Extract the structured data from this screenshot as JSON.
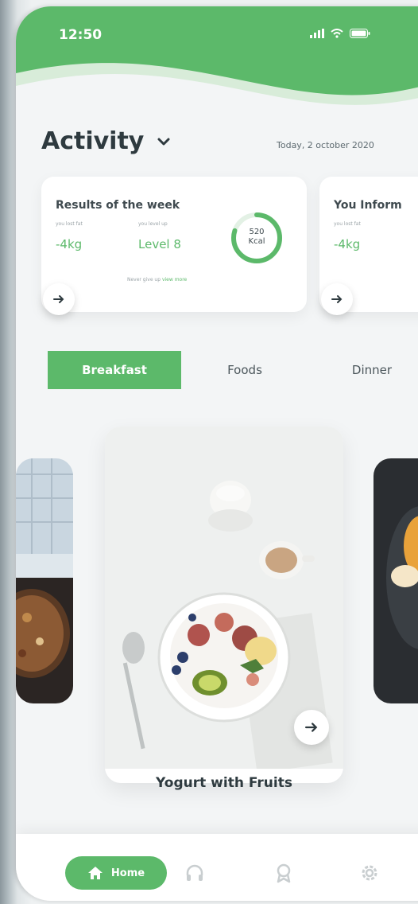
{
  "status_bar": {
    "time": "12:50"
  },
  "header": {
    "title": "Activity",
    "date": "Today, 2 october 2020"
  },
  "card_week": {
    "title": "Results of the week",
    "metric1_label": "you lost fat",
    "metric1_value": "-4kg",
    "metric2_label": "you level up",
    "metric2_value": "Level 8",
    "ring_value": "520",
    "ring_unit": "Kcal",
    "ring_progress": 0.8,
    "footnote_text": "Never give up",
    "footnote_link": "view more"
  },
  "card_info": {
    "title": "You Inform",
    "metric1_label": "you lost fat",
    "metric1_value": "-4kg"
  },
  "tabs": [
    {
      "label": "Breakfast",
      "active": true
    },
    {
      "label": "Foods",
      "active": false
    },
    {
      "label": "Dinner",
      "active": false
    }
  ],
  "featured": {
    "name": "Yogurt with Fruits"
  },
  "bottom_nav": {
    "home_label": "Home"
  },
  "colors": {
    "accent": "#5cb96a",
    "background": "#f3f5f6",
    "text": "#2e3a3f"
  }
}
